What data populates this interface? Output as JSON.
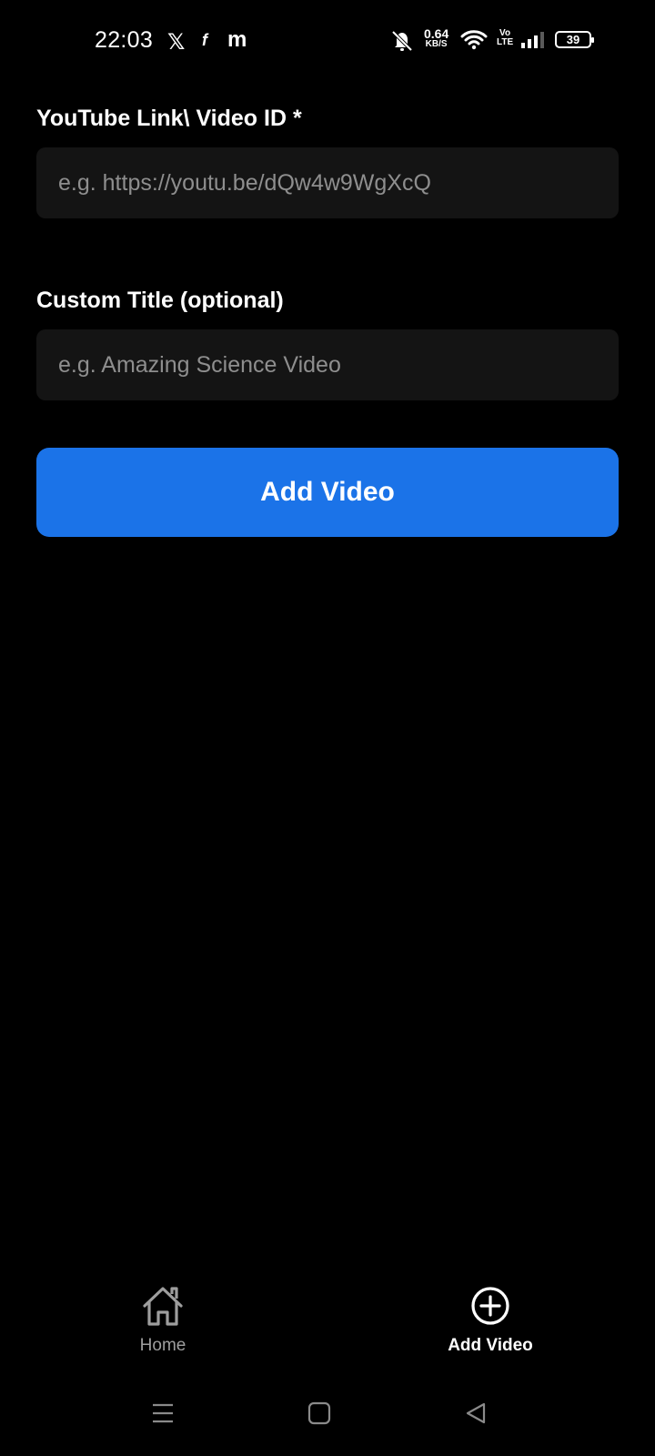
{
  "status_bar": {
    "time": "22:03",
    "net_speed_value": "0.64",
    "net_speed_unit": "KB/S",
    "volte_top": "Vo",
    "volte_bottom": "LTE",
    "battery": "39",
    "notification_icons": [
      "x-icon",
      "f-icon",
      "m-icon"
    ]
  },
  "form": {
    "link_label": "YouTube Link\\ Video ID *",
    "link_placeholder": "e.g. https://youtu.be/dQw4w9WgXcQ",
    "title_label": "Custom Title (optional)",
    "title_placeholder": "e.g. Amazing Science Video",
    "submit_label": "Add Video"
  },
  "bottom_nav": {
    "items": [
      {
        "label": "Home",
        "icon": "home-icon",
        "active": false
      },
      {
        "label": "Add Video",
        "icon": "add-circle-icon",
        "active": true
      }
    ]
  },
  "colors": {
    "background": "#000000",
    "input_background": "#141414",
    "accent": "#1b73e8",
    "inactive": "#9e9e9e"
  }
}
